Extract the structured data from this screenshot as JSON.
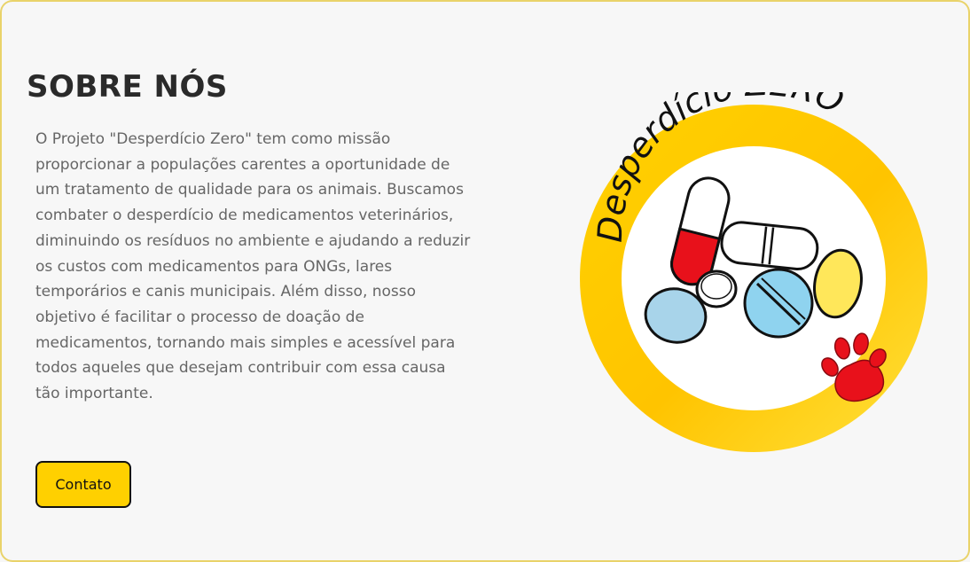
{
  "about": {
    "title": "SOBRE NÓS",
    "description": "O Projeto \"Desperdício Zero\" tem como missão proporcionar a populações carentes a oportunidade de um tratamento de qualidade para os animais. Buscamos combater o desperdício de medicamentos veterinários, diminuindo os resíduos no ambiente e ajudando a reduzir os custos com medicamentos para ONGs, lares temporários e canis municipais. Além disso, nosso objetivo é facilitar o processo de doação de medicamentos, tornando mais simples e acessível para todos aqueles que desejam contribuir com essa causa tão importante.",
    "contact_button": "Contato"
  },
  "logo": {
    "text": "Desperdício ZERO",
    "ring_color": "#ffd000",
    "paw_color": "#e8111b"
  },
  "colors": {
    "accent": "#ffd000",
    "title": "#2a2a2a",
    "body_text": "#666666"
  }
}
